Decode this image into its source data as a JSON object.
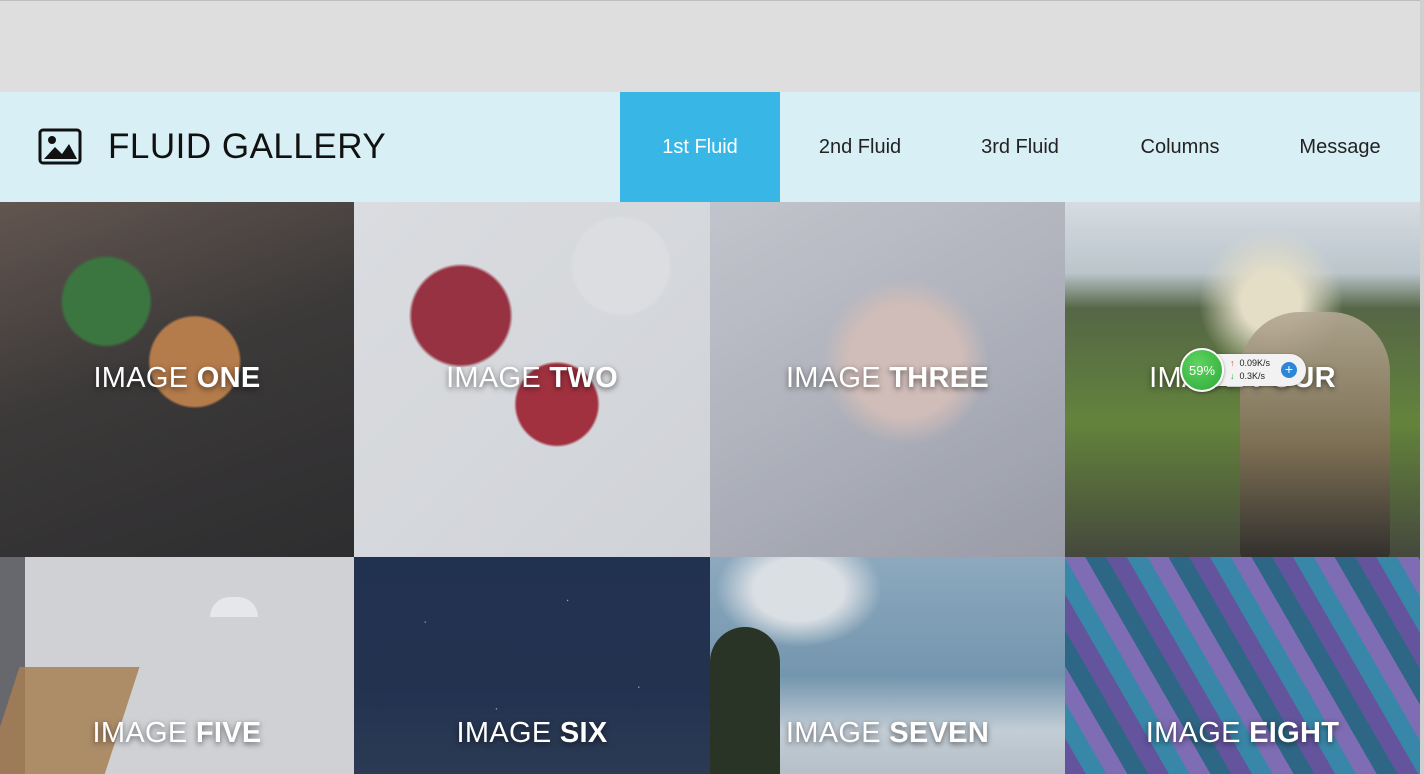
{
  "header": {
    "title": "FLUID GALLERY",
    "logo_icon": "image-icon"
  },
  "nav": {
    "items": [
      {
        "label": "1st Fluid",
        "active": true
      },
      {
        "label": "2nd Fluid",
        "active": false
      },
      {
        "label": "3rd Fluid",
        "active": false
      },
      {
        "label": "Columns",
        "active": false
      },
      {
        "label": "Message",
        "active": false
      }
    ]
  },
  "gallery": {
    "tiles": [
      {
        "prefix": "IMAGE",
        "word": "ONE"
      },
      {
        "prefix": "IMAGE",
        "word": "TWO"
      },
      {
        "prefix": "IMAGE",
        "word": "THREE"
      },
      {
        "prefix": "IMAGE",
        "word": "FOUR"
      },
      {
        "prefix": "IMAGE",
        "word": "FIVE"
      },
      {
        "prefix": "IMAGE",
        "word": "SIX"
      },
      {
        "prefix": "IMAGE",
        "word": "SEVEN"
      },
      {
        "prefix": "IMAGE",
        "word": "EIGHT"
      }
    ]
  },
  "speed_widget": {
    "percent": "59%",
    "upload": "0.09K/s",
    "download": "0.3K/s"
  },
  "colors": {
    "header_bg": "#d8eff6",
    "active_nav": "#38b6e6"
  }
}
